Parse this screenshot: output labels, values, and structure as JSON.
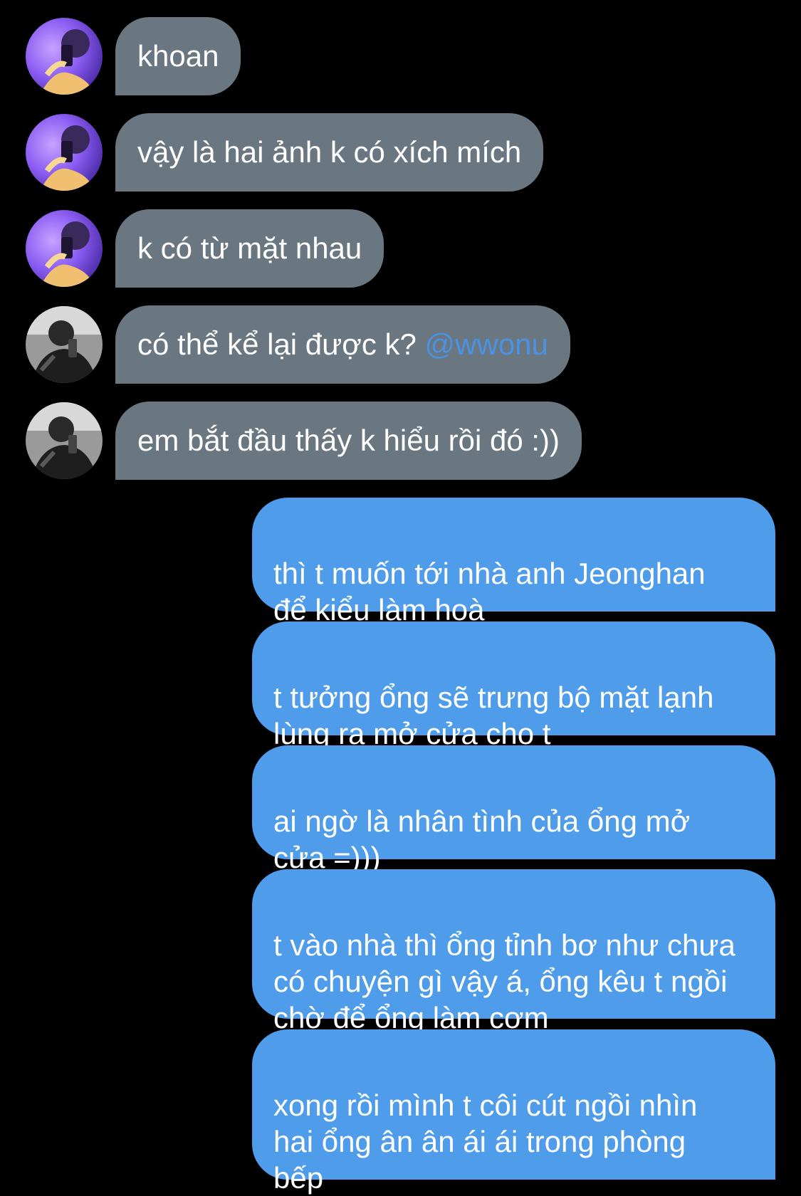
{
  "chat": {
    "colors": {
      "background": "#000000",
      "incoming_bubble": "#6a7680",
      "outgoing_bubble": "#4f9dea",
      "mention": "#4a92e3",
      "text": "#ffffff"
    },
    "incoming": [
      {
        "avatar": "avatar-purple-selfie-icon",
        "text": "khoan"
      },
      {
        "avatar": "avatar-purple-selfie-icon",
        "text": "vậy là hai ảnh k có xích mích"
      },
      {
        "avatar": "avatar-purple-selfie-icon",
        "text": "k có từ mặt nhau"
      },
      {
        "avatar": "avatar-bw-selfie-icon",
        "text": "có thể kể lại được k?",
        "mention": "@wwonu"
      },
      {
        "avatar": "avatar-bw-selfie-icon",
        "text": "em bắt đầu thấy k hiểu rồi đó :))"
      }
    ],
    "outgoing": [
      {
        "text": "thì t muốn tới nhà anh Jeonghan\nđể kiểu làm hoà"
      },
      {
        "text": "t tưởng ổng sẽ trưng bộ mặt lạnh\nlùng ra mở cửa cho t"
      },
      {
        "text": "ai ngờ là nhân tình của ổng mở\ncửa =)))"
      },
      {
        "text": "t vào nhà thì ổng tỉnh bơ như chưa\ncó chuyện gì vậy á, ổng kêu t ngồi\nchờ để ổng làm cơm"
      },
      {
        "text": "xong rồi mình t côi cút ngồi nhìn\nhai ổng ân ân ái ái trong phòng\nbếp"
      }
    ]
  }
}
